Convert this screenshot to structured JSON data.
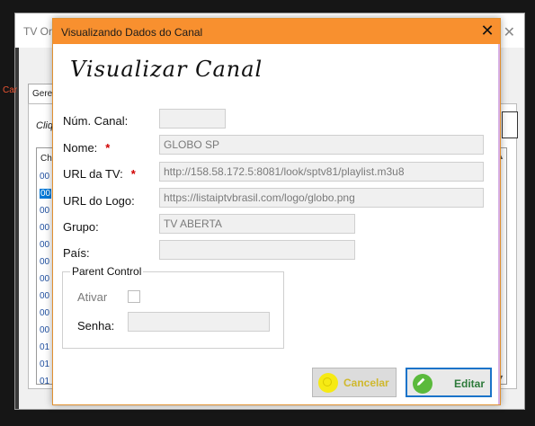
{
  "background_window": {
    "title": "TV Or",
    "side_text": "Car",
    "tab_label": "Gerer",
    "clique_text": "Cliq",
    "list_header": "Ch",
    "list_rows": [
      "00",
      "00",
      "00",
      "00",
      "00",
      "00",
      "00",
      "00",
      "00",
      "00",
      "01",
      "01",
      "01"
    ],
    "close_glyph": "✕"
  },
  "dialog": {
    "title": "Visualizando Dados do Canal",
    "close_glyph": "✕",
    "heading": "Visualizar Canal",
    "fields": {
      "num_canal": {
        "label": "Núm. Canal:",
        "value": ""
      },
      "nome": {
        "label": "Nome:",
        "required_mark": "*",
        "value": "GLOBO SP"
      },
      "url_tv": {
        "label": "URL da TV:",
        "required_mark": "*",
        "value": "http://158.58.172.5:8081/look/sptv81/playlist.m3u8"
      },
      "url_logo": {
        "label": "URL do Logo:",
        "value": "https://listaiptvbrasil.com/logo/globo.png"
      },
      "grupo": {
        "label": "Grupo:",
        "value": "TV ABERTA"
      },
      "pais": {
        "label": "País:",
        "value": ""
      }
    },
    "parent_control": {
      "legend": "Parent Control",
      "ativar_label": "Ativar",
      "ativar_checked": false,
      "senha_label": "Senha:",
      "senha_value": ""
    },
    "buttons": {
      "cancel_label": "Cancelar",
      "cancel_icon": "cancel-circle-icon",
      "edit_label": "Editar",
      "edit_icon": "pencil-icon"
    }
  },
  "colors": {
    "titlebar": "#f8902f",
    "required": "#d00000",
    "edit_border": "#1a73c9",
    "cancel_text": "#cfb82d",
    "edit_text": "#2d7a3a"
  }
}
